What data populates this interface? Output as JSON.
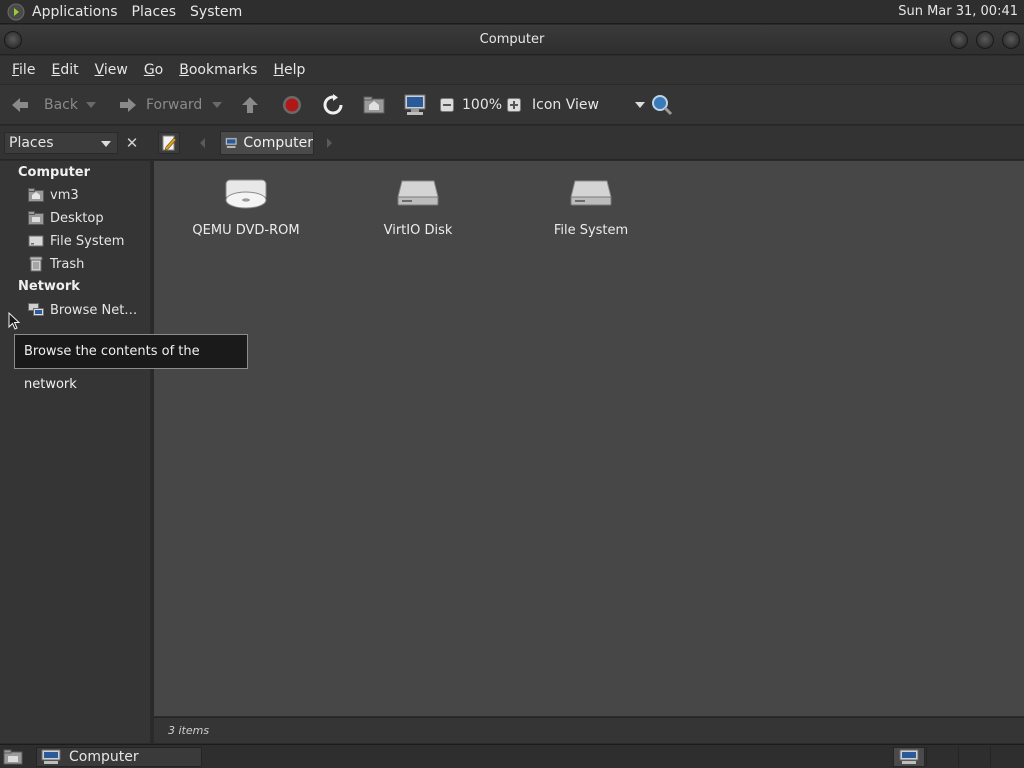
{
  "top_panel": {
    "menus": [
      "Applications",
      "Places",
      "System"
    ],
    "clock": "Sun Mar 31, 00:41"
  },
  "window": {
    "title": "Computer"
  },
  "menubar": {
    "items": [
      {
        "mnemonic": "F",
        "rest": "ile"
      },
      {
        "mnemonic": "E",
        "rest": "dit"
      },
      {
        "mnemonic": "V",
        "rest": "iew"
      },
      {
        "mnemonic": "G",
        "rest": "o"
      },
      {
        "mnemonic": "B",
        "rest": "ookmarks"
      },
      {
        "mnemonic": "H",
        "rest": "elp"
      }
    ]
  },
  "toolbar": {
    "back_label": "Back",
    "forward_label": "Forward",
    "zoom_level": "100%",
    "view_mode": "Icon View"
  },
  "location": {
    "pane_selector": "Places",
    "breadcrumb": "Computer"
  },
  "sidebar": {
    "sections": [
      {
        "header": "Computer",
        "items": [
          "vm3",
          "Desktop",
          "File System",
          "Trash"
        ]
      },
      {
        "header": "Network",
        "items": [
          "Browse Net…"
        ]
      }
    ]
  },
  "main": {
    "drives": [
      {
        "label": "QEMU DVD-ROM",
        "icon": "optical-drive-icon"
      },
      {
        "label": "VirtIO Disk",
        "icon": "hard-disk-icon"
      },
      {
        "label": "File System",
        "icon": "hard-disk-icon"
      }
    ]
  },
  "statusbar": {
    "text": "3 items"
  },
  "tooltip": {
    "text": "Browse the contents of the network"
  },
  "taskbar": {
    "task_label": "Computer"
  }
}
